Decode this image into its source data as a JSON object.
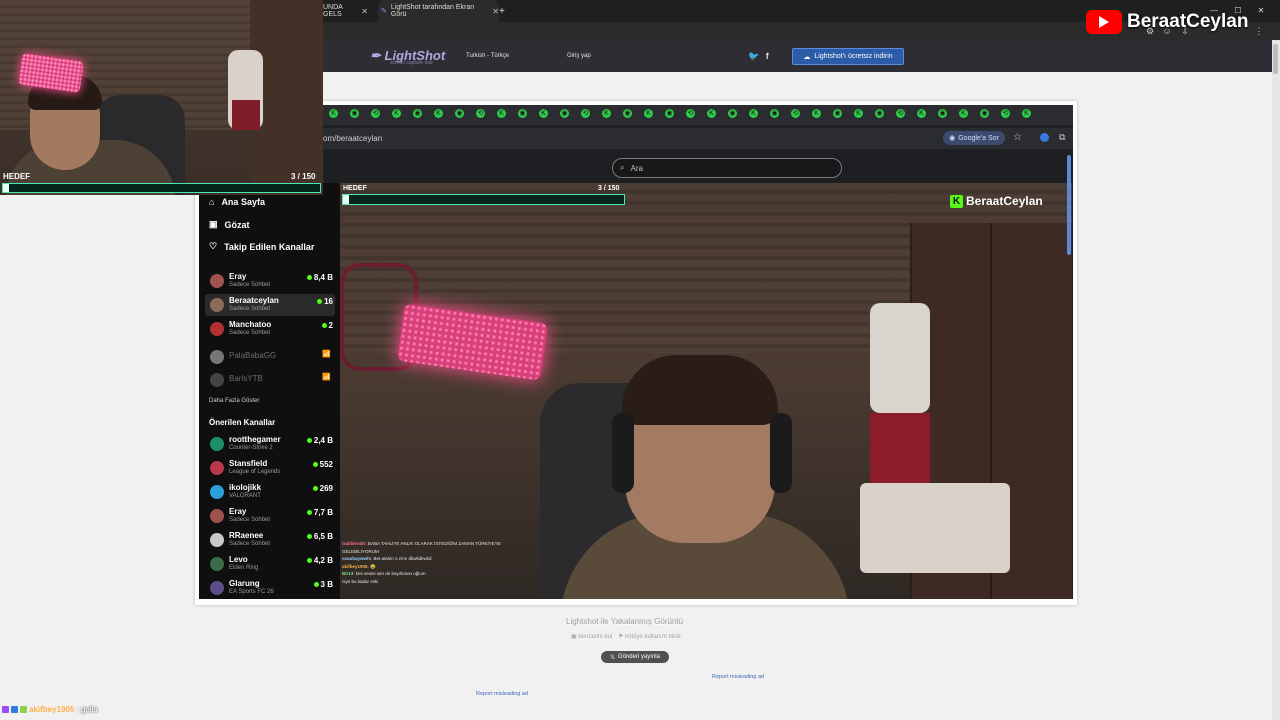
{
  "browser": {
    "tabs": [
      {
        "label": "UNDA GELS"
      },
      {
        "label": "LightShot tarafından Ekran Görü"
      }
    ],
    "new_tab": "+"
  },
  "lightshot": {
    "logo": "LightShot",
    "logo_sub": "screen capture tool",
    "language": "Turkish - Türkçe",
    "login": "Giriş yap",
    "download": "Lightshot'ı ücretsiz indirin",
    "caption": "Lightshot ile Yakalanmış Görüntü",
    "find_similar": "benzerini bul",
    "report_abuse": "kötüye kullanım bildir",
    "post": "Gönderi yayınla",
    "report_ad_left": "Report misleading ad",
    "report_ad_right": "Report misleading ad"
  },
  "inner_browser": {
    "url": "om/beraatceylan",
    "google_chip": "Google'a Sor",
    "search_placeholder": "Ara"
  },
  "sidebar": {
    "nav": [
      {
        "label": "Ana Sayfa",
        "icon": "home-icon"
      },
      {
        "label": "Gözat",
        "icon": "browse-icon"
      },
      {
        "label": "Takip Edilen Kanallar",
        "icon": "heart-icon"
      }
    ],
    "followed": [
      {
        "name": "Eray",
        "category": "Sadece Sohbet",
        "viewers": "8,4 B",
        "avatar": "#a0524f"
      },
      {
        "name": "Beraatceylan",
        "category": "Sadece Sohbet",
        "viewers": "16",
        "avatar": "#8e6b58"
      },
      {
        "name": "Manchatoo",
        "category": "Sadece Sohbet",
        "viewers": "2",
        "avatar": "#b23030"
      }
    ],
    "offline": [
      {
        "name": "PalaBabaGG",
        "avatar": "#777777"
      },
      {
        "name": "BarisYTB",
        "avatar": "#444444"
      }
    ],
    "show_more": "Daha Fazla Göster",
    "recommended_title": "Önerilen Kanallar",
    "recommended": [
      {
        "name": "rootthegamer",
        "category": "Counter-Strike 2",
        "viewers": "2,4 B",
        "avatar": "#1b8f6a"
      },
      {
        "name": "Stansfield",
        "category": "League of Legends",
        "viewers": "552",
        "avatar": "#b7384a"
      },
      {
        "name": "ikolojikk",
        "category": "VALORANT",
        "viewers": "269",
        "avatar": "#2a9fd8"
      },
      {
        "name": "Eray",
        "category": "Sadece Sohbet",
        "viewers": "7,7 B",
        "avatar": "#a0524f"
      },
      {
        "name": "RRaenee",
        "category": "Sadece Sohbet",
        "viewers": "6,5 B",
        "avatar": "#c9c9c9"
      },
      {
        "name": "Levo",
        "category": "Elden Ring",
        "viewers": "4,2 B",
        "avatar": "#3d6b4c"
      },
      {
        "name": "Glarung",
        "category": "EA Sports FC 26",
        "viewers": "3 B",
        "avatar": "#5d4b8a"
      }
    ]
  },
  "stream": {
    "goal_label": "HEDEF",
    "goal_value": "3 / 150",
    "goal_fraction": 0.02,
    "channel_logo": "BeraatCeylan",
    "chat": [
      {
        "user": "Galiblendir",
        "text": ": BABA TAHLİYE ANLIK OLARAK İSTEDİĞİM ZAMAN TÜRKİYEYE"
      },
      {
        "user": "",
        "text": "GELEBİLİYORUM"
      },
      {
        "user": "ozanbaywwfs",
        "text": ": Bet atalım o zmn dkwkdkwkd"
      },
      {
        "user": "akifbey1905",
        "text": ": 😂"
      },
      {
        "user": "Bir13",
        "text": ": kes sesini sen de bayılıtıson oğlum"
      },
      {
        "user": "",
        "text": "niye bu kadar zeki"
      }
    ]
  },
  "overlay": {
    "webcam_goal_label": "HEDEF",
    "webcam_goal_value": "3 / 150",
    "brand": "BeraatCeylan",
    "bottom_chat_user": "akifbey1905",
    "bottom_chat_text": ": gelia"
  },
  "colors": {
    "kick_green": "#53fc18",
    "goal_border": "#4fe3b6",
    "youtube_red": "#ff0000",
    "lightshot_header": "#2d2d33"
  }
}
